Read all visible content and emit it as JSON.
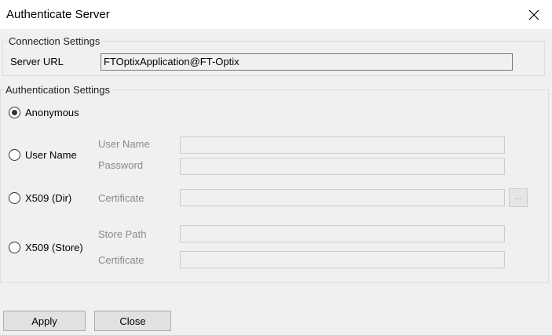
{
  "window": {
    "title": "Authenticate Server"
  },
  "connection": {
    "group_label": "Connection Settings",
    "server_url_label": "Server URL",
    "server_url_value": "FTOptixApplication@FT-Optix"
  },
  "auth": {
    "group_label": "Authentication Settings",
    "selected": "Anonymous",
    "options": {
      "anonymous": "Anonymous",
      "username": "User Name",
      "x509_dir": "X509 (Dir)",
      "x509_store": "X509 (Store)"
    },
    "fields": {
      "user_name_label": "User Name",
      "user_name_value": "",
      "password_label": "Password",
      "password_value": "",
      "dir_certificate_label": "Certificate",
      "dir_certificate_value": "",
      "browse_label": "...",
      "store_path_label": "Store Path",
      "store_path_value": "",
      "store_certificate_label": "Certificate",
      "store_certificate_value": ""
    }
  },
  "buttons": {
    "apply": "Apply",
    "close": "Close"
  },
  "icons": {
    "close": "close-icon"
  }
}
